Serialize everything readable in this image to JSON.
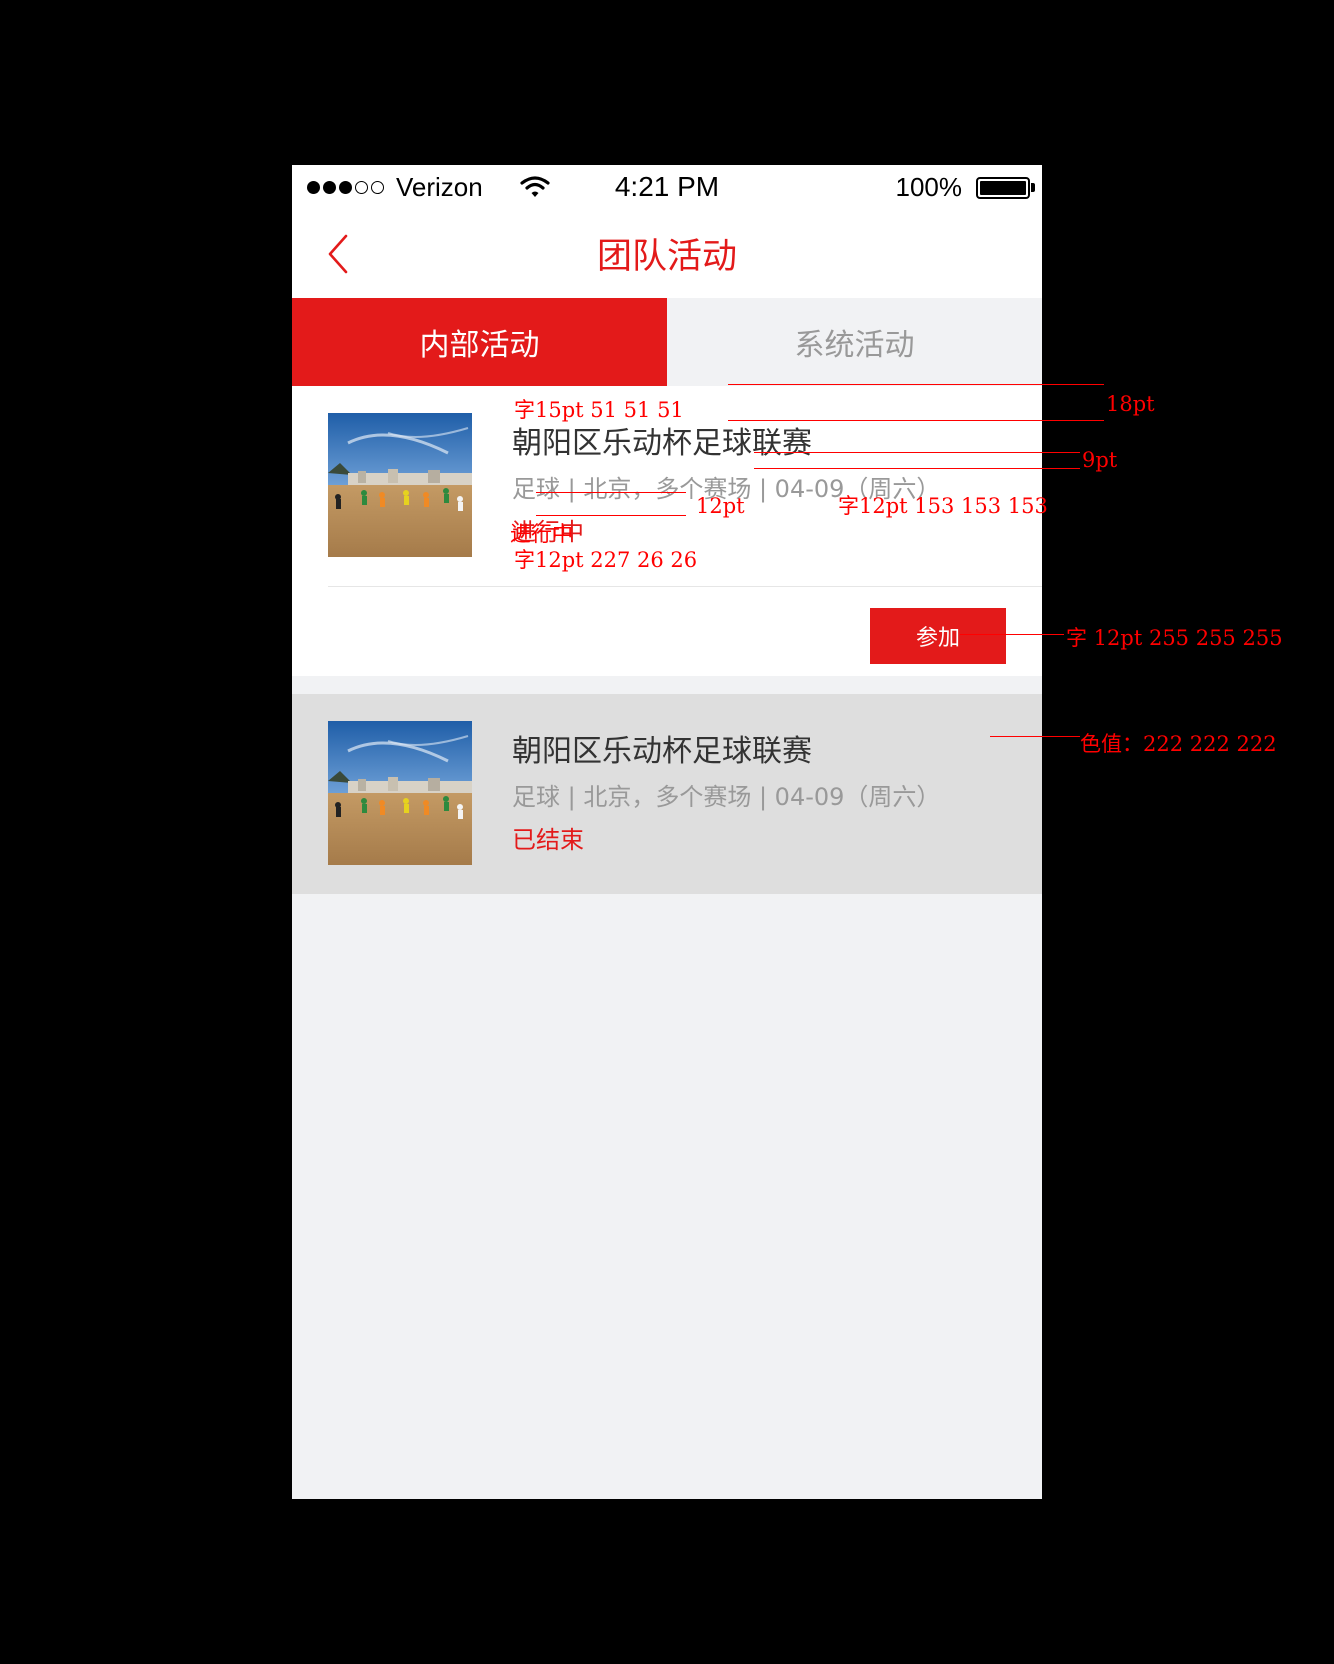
{
  "status_bar": {
    "carrier": "Verizon",
    "time": "4:21 PM",
    "battery": "100%",
    "signal_icon": "signal-dots-icon",
    "wifi_icon": "wifi-icon",
    "battery_icon": "battery-icon"
  },
  "nav": {
    "title": "团队活动",
    "back_icon": "chevron-left-icon"
  },
  "tabs": [
    {
      "label": "内部活动",
      "active": true
    },
    {
      "label": "系统活动",
      "active": false
    }
  ],
  "activities": [
    {
      "title": "朝阳区乐动杯足球联赛",
      "subtitle": "足球 | 北京，多个赛场 | 04-09（周六）",
      "status": "进行中",
      "action": "参加"
    },
    {
      "title": "朝阳区乐动杯足球联赛",
      "subtitle": "足球 | 北京，多个赛场 | 04-09（周六）",
      "status": "已结束"
    }
  ],
  "annotations": {
    "title_font": "字15pt  51  51  51",
    "gap_top": "18pt",
    "gap_mid": "9pt",
    "gap_sub": "12pt",
    "sub_font": "字12pt  153  153  153",
    "status_label": "进行中",
    "status_font": "字12pt  227  26  26",
    "button_font": "字  12pt  255  255  255",
    "bg_color": "色值：222  222  222"
  },
  "colors": {
    "accent": "#e31a1a",
    "title_text": "#333333",
    "sub_text": "#999999",
    "ended_bg": "#dedede",
    "page_bg": "#f1f2f4"
  }
}
